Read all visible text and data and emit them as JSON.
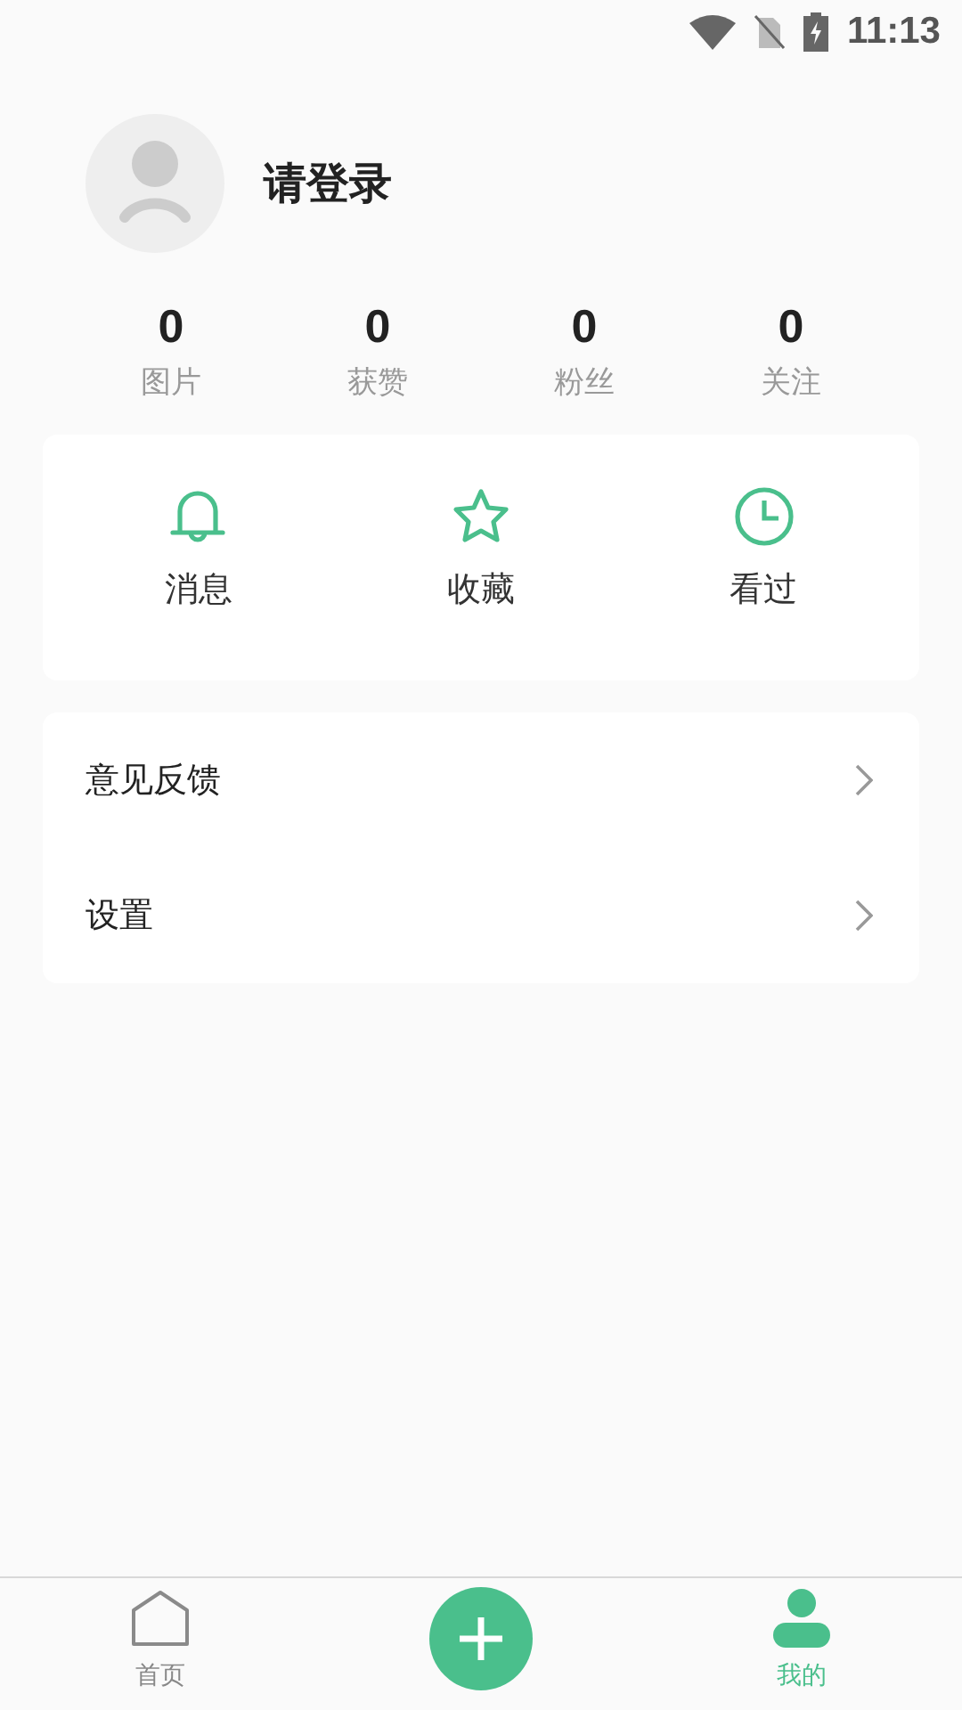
{
  "status_bar": {
    "time": "11:13"
  },
  "profile": {
    "name": "请登录"
  },
  "stats": [
    {
      "value": "0",
      "label": "图片"
    },
    {
      "value": "0",
      "label": "获赞"
    },
    {
      "value": "0",
      "label": "粉丝"
    },
    {
      "value": "0",
      "label": "关注"
    }
  ],
  "shortcuts": [
    {
      "kind": "bell",
      "label": "消息"
    },
    {
      "kind": "star",
      "label": "收藏"
    },
    {
      "kind": "clock",
      "label": "看过"
    }
  ],
  "menu": [
    {
      "label": "意见反馈"
    },
    {
      "label": "设置"
    }
  ],
  "tab_bar": [
    {
      "kind": "home",
      "label": "首页",
      "selected": false
    },
    {
      "kind": "add",
      "selected": false
    },
    {
      "kind": "profile",
      "label": "我的",
      "selected": true
    }
  ]
}
